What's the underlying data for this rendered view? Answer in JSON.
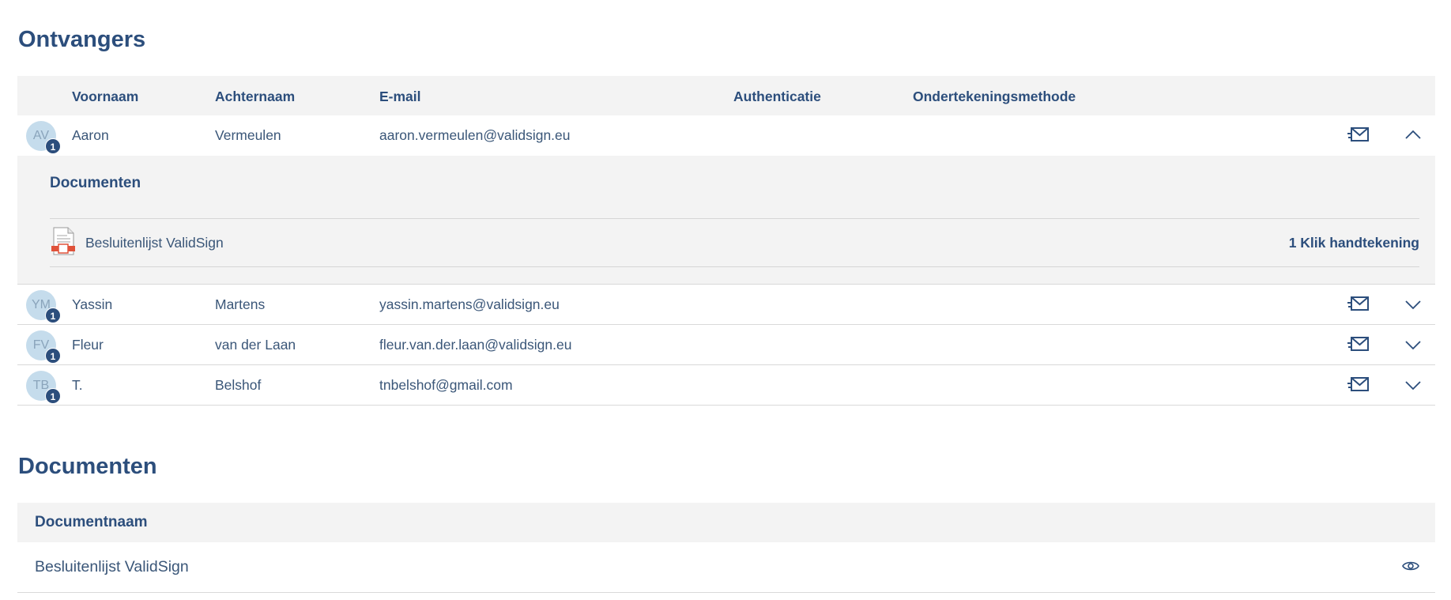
{
  "recipients_section": {
    "title": "Ontvangers",
    "columns": {
      "first_name": "Voornaam",
      "last_name": "Achternaam",
      "email": "E-mail",
      "authentication": "Authenticatie",
      "signing_method": "Ondertekeningsmethode"
    },
    "rows": [
      {
        "initials": "AV",
        "badge": "1",
        "first_name": "Aaron",
        "last_name": "Vermeulen",
        "email": "aaron.vermeulen@validsign.eu",
        "expanded": true
      },
      {
        "initials": "YM",
        "badge": "1",
        "first_name": "Yassin",
        "last_name": "Martens",
        "email": "yassin.martens@validsign.eu",
        "expanded": false
      },
      {
        "initials": "FV",
        "badge": "1",
        "first_name": "Fleur",
        "last_name": "van der Laan",
        "email": "fleur.van.der.laan@validsign.eu",
        "expanded": false
      },
      {
        "initials": "TB",
        "badge": "1",
        "first_name": "T.",
        "last_name": "Belshof",
        "email": "tnbelshof@gmail.com",
        "expanded": false
      }
    ],
    "expanded_detail": {
      "title": "Documenten",
      "document_name": "Besluitenlijst ValidSign",
      "signing_method": "1 Klik handtekening",
      "document_icon": "pdf-document-icon"
    }
  },
  "documents_section": {
    "title": "Documenten",
    "column_header": "Documentnaam",
    "rows": [
      {
        "name": "Besluitenlijst ValidSign",
        "action_icon": "eye-icon"
      }
    ]
  },
  "icons": {
    "send_email": "mail-send-icon",
    "expand": "chevron-down-icon",
    "collapse": "chevron-up-icon"
  },
  "colors": {
    "heading": "#2c4e7c",
    "text": "#3a5678",
    "header_bg": "#f3f3f3",
    "avatar_bg": "#c5dcec",
    "badge_bg": "#2c4e7c"
  }
}
